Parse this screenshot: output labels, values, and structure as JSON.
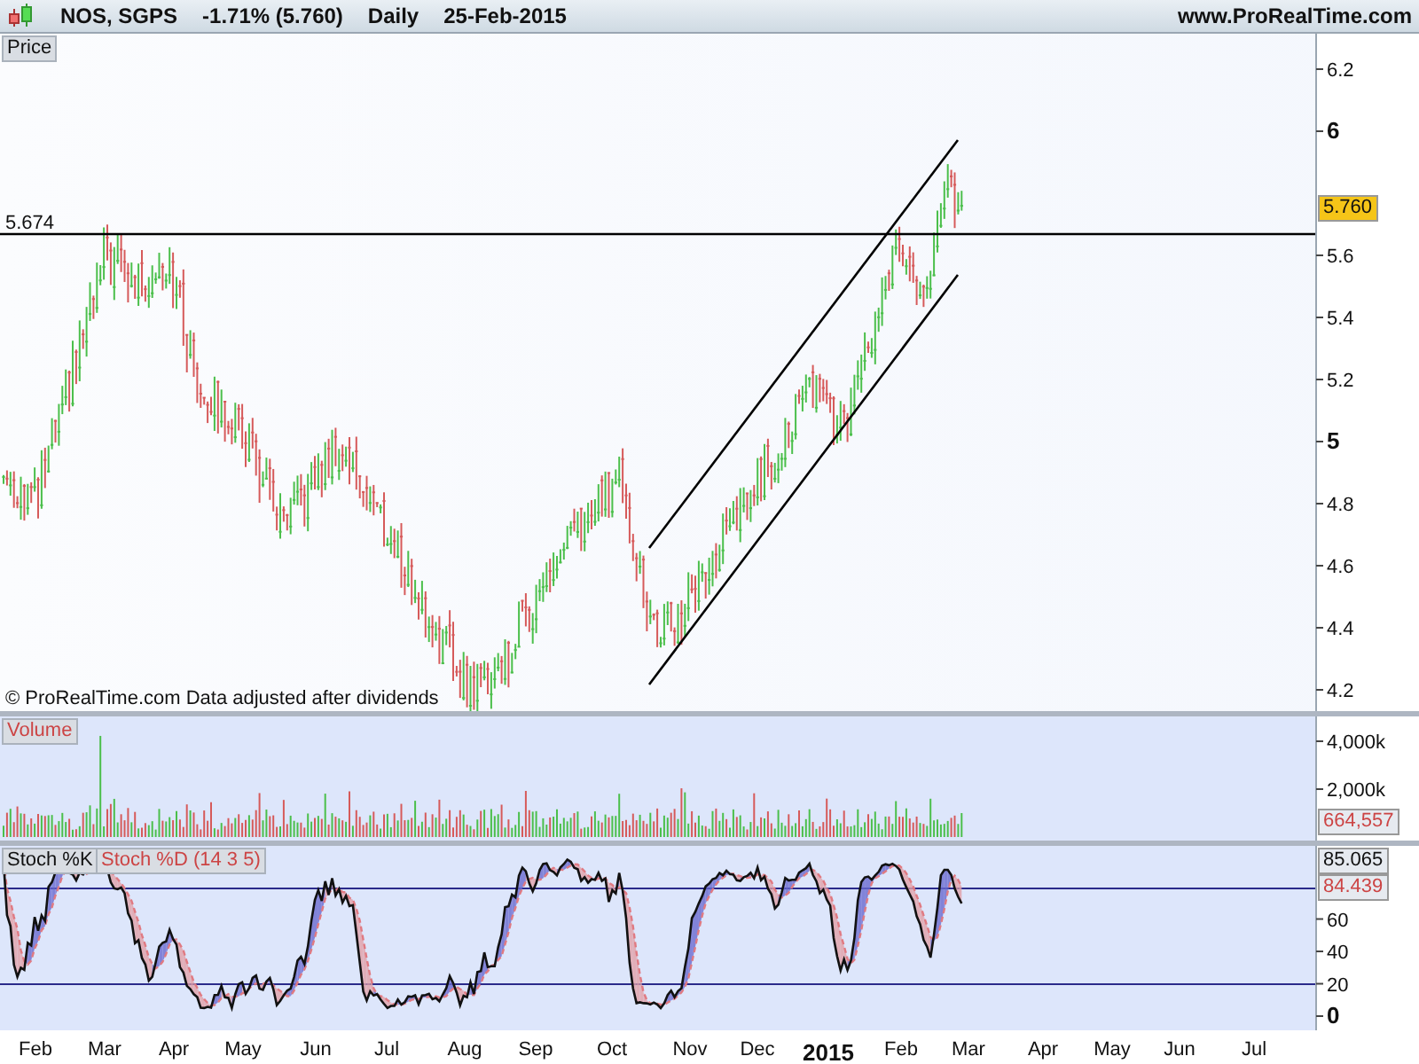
{
  "header": {
    "title": "NOS, SGPS",
    "change": "-1.71% (5.760)",
    "period": "Daily",
    "date": "25-Feb-2015",
    "site": "www.ProRealTime.com"
  },
  "price_pane": {
    "label": "Price",
    "level_line_label": "5.674",
    "last_price": "5.760",
    "footer": "© ProRealTime.com  Data adjusted after dividends",
    "axis_labels": [
      {
        "text": "6.2",
        "kind": "minor"
      },
      {
        "text": "6",
        "kind": "major"
      },
      {
        "text": "5.6",
        "kind": "minor"
      },
      {
        "text": "5.4",
        "kind": "minor"
      },
      {
        "text": "5.2",
        "kind": "minor"
      },
      {
        "text": "5",
        "kind": "major"
      },
      {
        "text": "4.8",
        "kind": "minor"
      },
      {
        "text": "4.6",
        "kind": "minor"
      },
      {
        "text": "4.4",
        "kind": "minor"
      },
      {
        "text": "4.2",
        "kind": "minor"
      }
    ]
  },
  "volume_pane": {
    "label": "Volume",
    "axis_labels": [
      "4,000k",
      "2,000k"
    ],
    "last_value": "664,557"
  },
  "stoch_pane": {
    "k_label": "Stoch %K",
    "d_label": "Stoch %D (14 3 5)",
    "k_value": "85.065",
    "d_value": "84.439",
    "axis_labels": [
      {
        "text": "60",
        "kind": "minor"
      },
      {
        "text": "40",
        "kind": "minor"
      },
      {
        "text": "20",
        "kind": "minor"
      },
      {
        "text": "0",
        "kind": "major"
      }
    ]
  },
  "x_axis": [
    {
      "text": "Feb",
      "kind": "month"
    },
    {
      "text": "Mar",
      "kind": "month"
    },
    {
      "text": "Apr",
      "kind": "month"
    },
    {
      "text": "May",
      "kind": "month"
    },
    {
      "text": "Jun",
      "kind": "month"
    },
    {
      "text": "Jul",
      "kind": "month"
    },
    {
      "text": "Aug",
      "kind": "month"
    },
    {
      "text": "Sep",
      "kind": "month"
    },
    {
      "text": "Oct",
      "kind": "month"
    },
    {
      "text": "Nov",
      "kind": "month"
    },
    {
      "text": "Dec",
      "kind": "month"
    },
    {
      "text": "2015",
      "kind": "year"
    },
    {
      "text": "Feb",
      "kind": "month"
    },
    {
      "text": "Mar",
      "kind": "month"
    },
    {
      "text": "Apr",
      "kind": "month"
    },
    {
      "text": "May",
      "kind": "month"
    },
    {
      "text": "Jun",
      "kind": "month"
    },
    {
      "text": "Jul",
      "kind": "month"
    }
  ]
}
